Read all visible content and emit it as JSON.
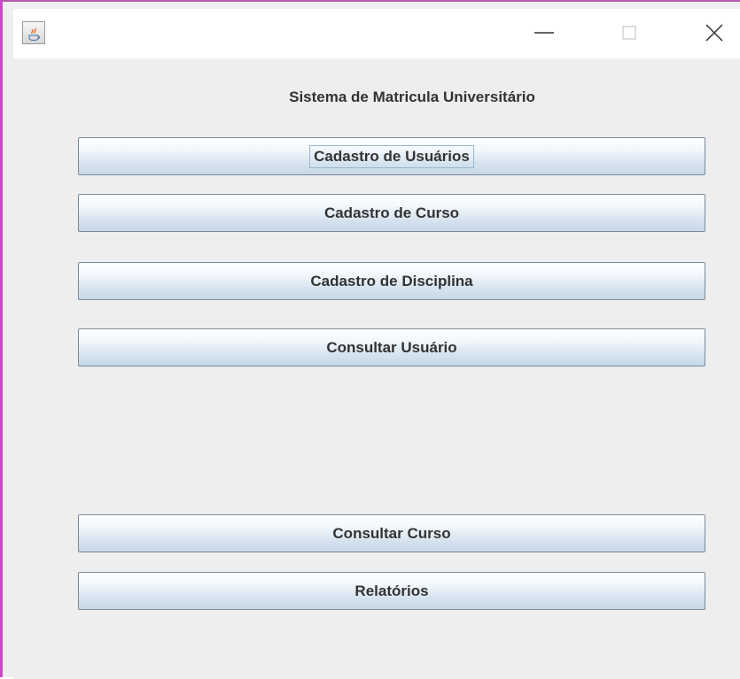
{
  "window": {
    "controls": {
      "minimize_icon": "minimize-icon",
      "maximize_icon": "maximize-icon",
      "close_icon": "close-icon"
    },
    "app_icon": "java-icon"
  },
  "main": {
    "title": "Sistema de Matricula Universitário",
    "buttons": [
      {
        "label": "Cadastro de Usuários",
        "focused": true
      },
      {
        "label": "Cadastro de Curso"
      },
      {
        "label": "Cadastro de Disciplina"
      },
      {
        "label": "Consultar Usuário"
      },
      {
        "label": "Consultar Curso"
      },
      {
        "label": "Relatórios"
      }
    ]
  },
  "colors": {
    "window_border": "#c94bc4",
    "content_bg": "#eeeeee",
    "button_gradient_top": "#ffffff",
    "button_gradient_bottom": "#c7d8e7",
    "button_border": "#7a8a99"
  }
}
